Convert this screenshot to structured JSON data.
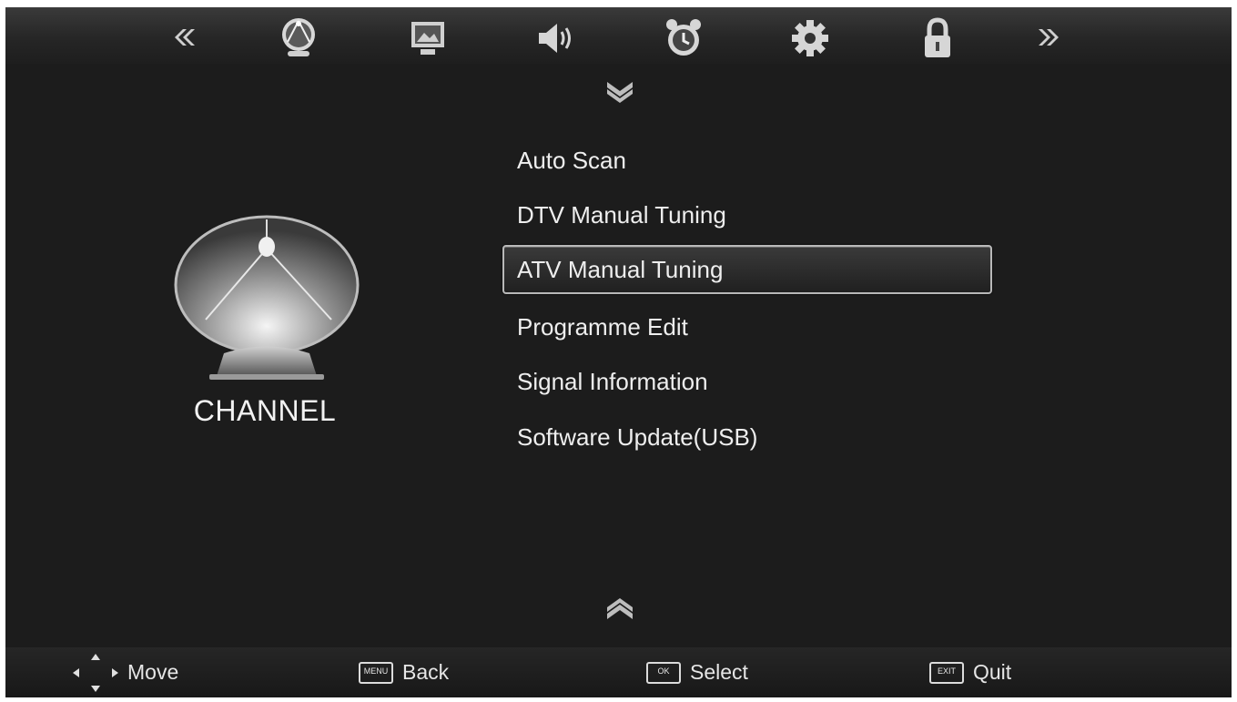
{
  "category": {
    "label": "CHANNEL"
  },
  "menu": {
    "items": [
      {
        "label": "Auto Scan",
        "selected": false
      },
      {
        "label": "DTV Manual Tuning",
        "selected": false
      },
      {
        "label": "ATV Manual Tuning",
        "selected": true
      },
      {
        "label": "Programme Edit",
        "selected": false
      },
      {
        "label": "Signal Information",
        "selected": false
      },
      {
        "label": "Software Update(USB)",
        "selected": false
      }
    ]
  },
  "topbar": {
    "icons": [
      "left-arrows-icon",
      "satellite-dish-icon",
      "picture-icon",
      "speaker-icon",
      "alarm-clock-icon",
      "gear-icon",
      "lock-icon",
      "right-arrows-icon"
    ],
    "active": "satellite-dish-icon"
  },
  "footer": {
    "move": "Move",
    "back": "Back",
    "back_key": "MENU",
    "select": "Select",
    "select_key": "OK",
    "quit": "Quit",
    "quit_key": "EXIT"
  },
  "colors": {
    "background": "#1c1c1c",
    "text": "#eeeeee",
    "highlight_border": "#b8b8b8"
  }
}
